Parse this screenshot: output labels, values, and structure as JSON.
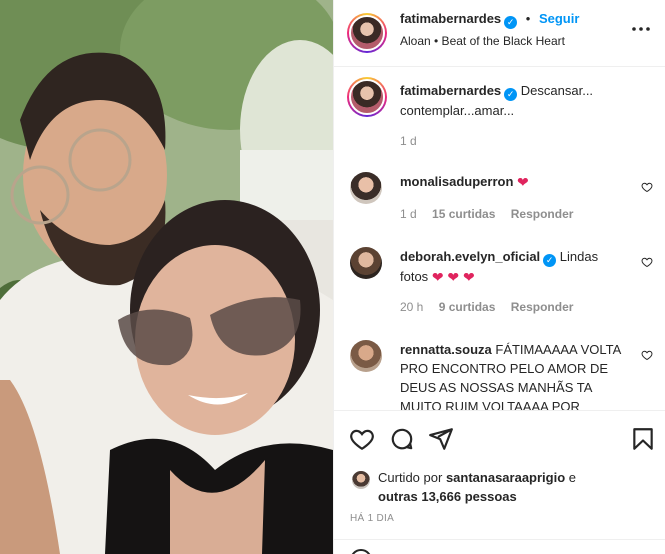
{
  "post": {
    "author": "fatimabernardes",
    "follow_label": "Seguir",
    "separator": "•",
    "audio": "Aloan • Beat of the Black Heart",
    "more_icon": "more-horizontal-icon"
  },
  "caption": {
    "author": "fatimabernardes",
    "text_line1": "Descansar...",
    "text_line2": "contemplar...amar...",
    "time": "1 d"
  },
  "comments": [
    {
      "author": "monalisaduperron",
      "text_line1": "",
      "hearts": "❤",
      "time": "1 d",
      "likes": "15 curtidas",
      "reply": "Responder"
    },
    {
      "author": "deborah.evelyn_oficial",
      "text_line1": "Lindas",
      "text_line2": "fotos",
      "hearts": "❤ ❤ ❤",
      "time": "20 h",
      "likes": "9 curtidas",
      "reply": "Responder"
    },
    {
      "author": "rennatta.souza",
      "text_line1": "FÁTIMAAAAA VOLTA",
      "text_line2": "PRO ENCONTRO PELO AMOR DE",
      "text_line3": "DEUS AS NOSSAS MANHÃS TA",
      "text_line4": "MUITO RUIM VOLTAAAA POR"
    }
  ],
  "likes_summary": {
    "prefix": "Curtido por",
    "user": "santanasaraaprigio",
    "suffix": "e",
    "others": "outras 13,666 pessoas"
  },
  "timestamp": "HÁ 1 DIA",
  "colors": {
    "accent": "#0095f6",
    "heart": "#e0245e",
    "muted": "#8e8e8e"
  }
}
